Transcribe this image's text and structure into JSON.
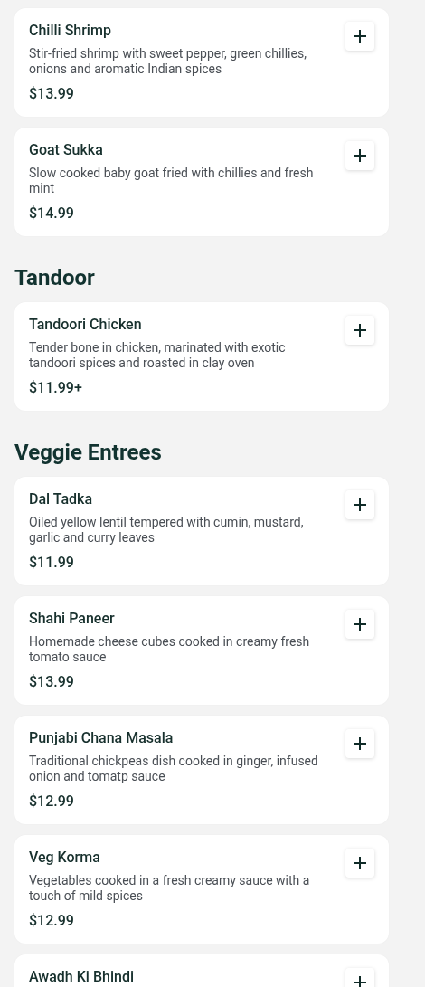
{
  "sections": [
    {
      "items": [
        {
          "name": "Chilli Shrimp",
          "description": "Stir-fried shrimp with sweet pepper, green chillies, onions and aromatic Indian spices",
          "price": "$13.99"
        },
        {
          "name": "Goat Sukka",
          "description": "Slow cooked baby goat fried with chillies and fresh mint",
          "price": "$14.99"
        }
      ]
    },
    {
      "heading": "Tandoor",
      "items": [
        {
          "name": "Tandoori Chicken",
          "description": "Tender bone in chicken, marinated with exotic tandoori spices and roasted in clay oven",
          "price": "$11.99+"
        }
      ]
    },
    {
      "heading": "Veggie Entrees",
      "items": [
        {
          "name": "Dal Tadka",
          "description": "Oiled yellow lentil tempered with cumin, mustard, garlic and curry leaves",
          "price": "$11.99"
        },
        {
          "name": "Shahi Paneer",
          "description": "Homemade cheese cubes cooked in creamy fresh tomato sauce",
          "price": "$13.99"
        },
        {
          "name": "Punjabi Chana Masala",
          "description": "Traditional chickpeas dish cooked in ginger, infused onion and tomatp sauce",
          "price": "$12.99"
        },
        {
          "name": "Veg Korma",
          "description": "Vegetables cooked in a fresh creamy sauce with a touch of mild spices",
          "price": "$12.99"
        },
        {
          "name": "Awadh Ki Bhindi"
        }
      ]
    }
  ]
}
